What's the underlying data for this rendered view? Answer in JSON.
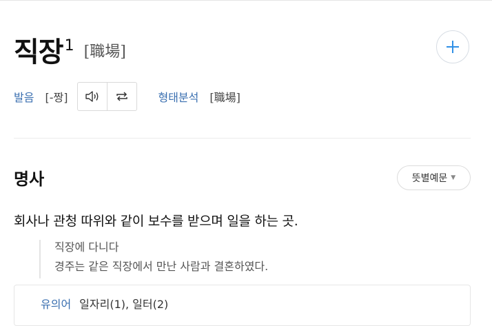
{
  "entry": {
    "headword": "직장",
    "homonym_number": "1",
    "hanja": "[職場]"
  },
  "pronunciation": {
    "label": "발음",
    "value": "[-짱]",
    "speaker_icon": "speaker-icon",
    "repeat_icon": "repeat-icon"
  },
  "morphology": {
    "label": "형태분석",
    "value": "[職場]"
  },
  "actions": {
    "add_icon": "plus-icon",
    "accent_color": "#2f8fe6"
  },
  "sense": {
    "part_of_speech": "명사",
    "sort_button_label": "뜻별예문",
    "sort_caret_icon": "caret-down-icon",
    "definition": "회사나 관청 따위와 같이 보수를 받으며 일을 하는 곳.",
    "examples": [
      {
        "keyword": "직장",
        "rest": "에 다니다"
      },
      {
        "prefix": "경주는 같은 ",
        "keyword": "직장",
        "rest": "에서 만난 사람과 결혼하였다."
      }
    ],
    "synonyms": {
      "label": "유의어",
      "words": "일자리(1), 일터(2)"
    }
  }
}
